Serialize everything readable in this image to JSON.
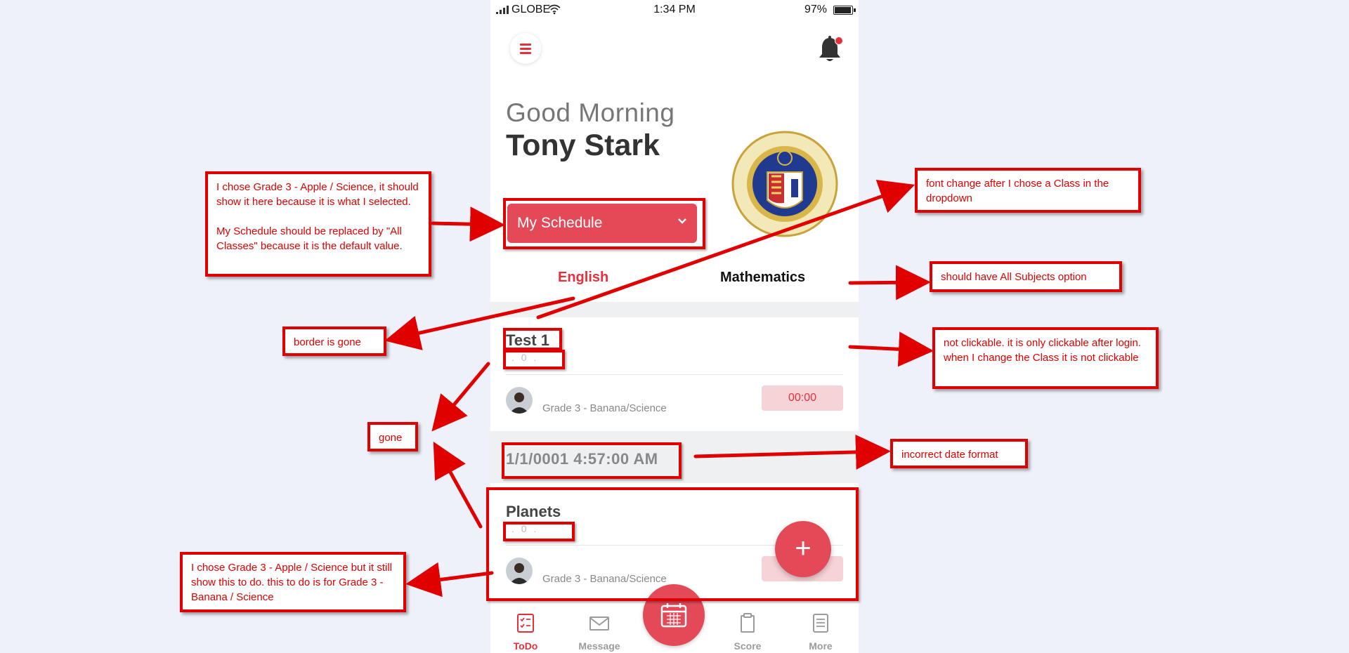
{
  "status_bar": {
    "carrier": "GLOBE",
    "time": "1:34 PM",
    "battery": "97%"
  },
  "header": {
    "menu_icon": "hamburger-icon",
    "notification_icon": "bell-icon",
    "has_unread": true
  },
  "greeting": {
    "line1": "Good Morning",
    "name": "Tony Stark"
  },
  "seal": {
    "alt": "school-seal-logo"
  },
  "schedule_select": {
    "value": "My Schedule",
    "icon": "chevron-down-icon"
  },
  "subject_tabs": [
    {
      "label": "English",
      "active": true
    },
    {
      "label": "Mathematics",
      "active": false
    }
  ],
  "todo_cards": [
    {
      "title": "Test 1",
      "subtitle": ". 0 .",
      "class_name": "Grade 3 - Banana/Science",
      "time": "00:00"
    },
    {
      "title": "Planets",
      "subtitle": ". 0 .",
      "class_name": "Grade 3 - Banana/Science",
      "time": ""
    }
  ],
  "date_header": "1/1/0001 4:57:00 AM",
  "add_button": {
    "icon": "plus-icon",
    "label": "+"
  },
  "bottom_nav": [
    {
      "label": "ToDo",
      "icon": "todo-checklist-icon",
      "active": true
    },
    {
      "label": "Message",
      "icon": "envelope-icon",
      "active": false
    },
    {
      "label": "Score",
      "icon": "score-clipboard-icon",
      "active": false
    },
    {
      "label": "More",
      "icon": "more-list-icon",
      "active": false
    }
  ],
  "calendar_button": {
    "icon": "calendar-icon"
  },
  "annotations": {
    "schedule_note": "I chose Grade 3 - Apple / Science, it should show it here because it is what I selected.\n\nMy Schedule should be replaced by \"All Classes\" because it is the default value.",
    "font_change_note": "font change after I chose a Class in the dropdown",
    "all_subjects_note": "should have All Subjects option",
    "border_note": "border is gone",
    "not_clickable_note": "not clickable. it is only clickable after login. when I change the Class it is not clickable",
    "gone_note": "gone",
    "date_note": "incorrect date format",
    "wrong_class_note": "I chose Grade 3 - Apple / Science but it still show this to do. this to do is for Grade 3 - Banana / Science"
  },
  "colors": {
    "accent": "#e4303c",
    "annotation": "#e00000",
    "page_bg": "#eef1f9"
  }
}
